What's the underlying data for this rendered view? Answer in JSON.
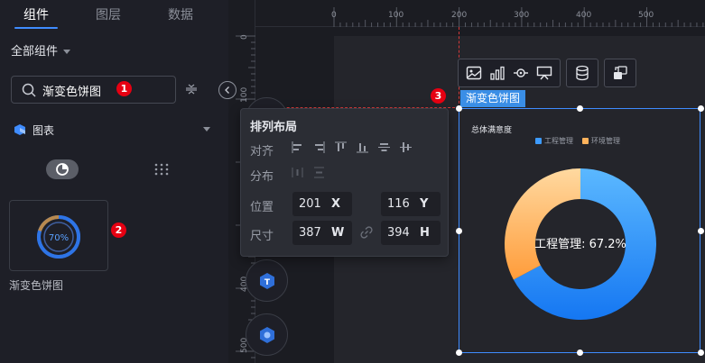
{
  "tabs": [
    {
      "label": "组件",
      "active": true
    },
    {
      "label": "图层",
      "active": false
    },
    {
      "label": "数据",
      "active": false
    }
  ],
  "sidebar": {
    "all_components_label": "全部组件",
    "search": {
      "value": "渐变色饼图",
      "placeholder": ""
    },
    "category_label": "图表",
    "component_card": {
      "preview_percent": "70%",
      "label": "渐变色饼图"
    }
  },
  "badges": {
    "one": "1",
    "two": "2",
    "three": "3"
  },
  "ruler": {
    "top_ticks": [
      "0",
      "100",
      "200",
      "300",
      "400",
      "500"
    ],
    "left_ticks": [
      "0",
      "100",
      "400",
      "500"
    ]
  },
  "widget": {
    "title_tag": "渐变色饼图",
    "chart_title": "总体满意度",
    "center_label": "工程管理: 67.2%"
  },
  "layout_popup": {
    "title": "排列布局",
    "align_label": "对齐",
    "distribute_label": "分布",
    "position_label": "位置",
    "size_label": "尺寸",
    "x_value": "201",
    "x_unit": "X",
    "y_value": "116",
    "y_unit": "Y",
    "w_value": "387",
    "w_unit": "W",
    "h_value": "394",
    "h_unit": "H"
  },
  "chart_data": {
    "type": "pie",
    "title": "总体满意度",
    "series": [
      {
        "name": "工程管理",
        "value": 67.2,
        "color_start": "#5bb8ff",
        "color_end": "#1577f2"
      },
      {
        "name": "环境管理",
        "value": 32.8,
        "color_start": "#ffd9a0",
        "color_end": "#ff9c3a"
      }
    ],
    "legend_position": "top-right"
  },
  "colors": {
    "accent": "#3f8cff",
    "badge": "#e60012",
    "guide": "#d43a3a"
  }
}
